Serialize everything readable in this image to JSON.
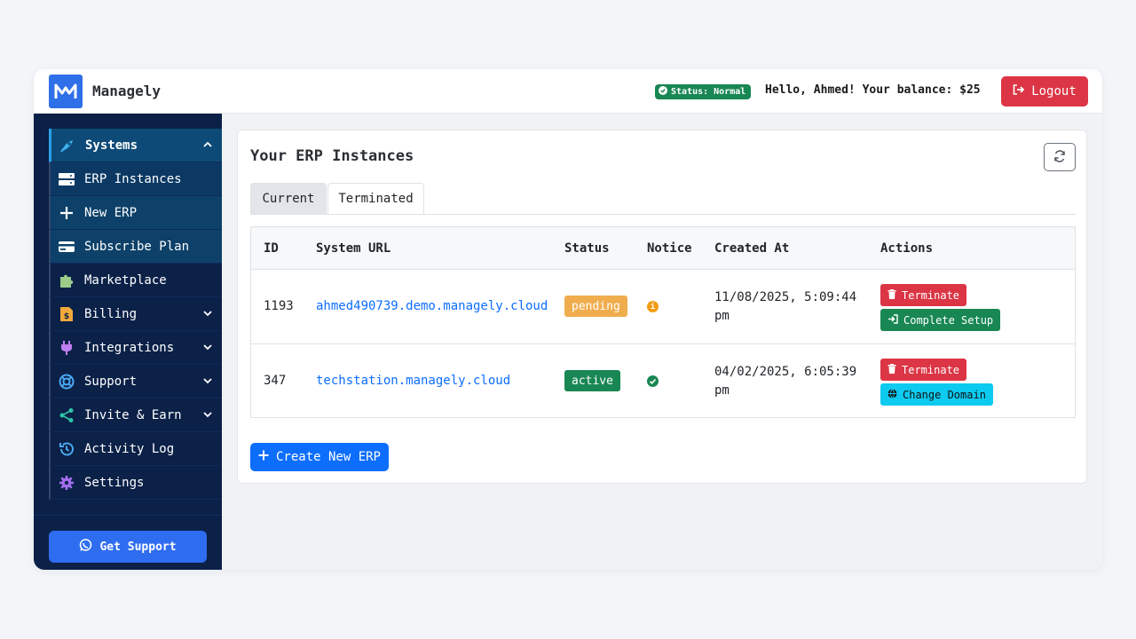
{
  "app": {
    "brand": "Managely"
  },
  "header": {
    "status_label": "Status: Normal",
    "greeting": "Hello, Ahmed! Your balance: $25",
    "logout_label": "Logout"
  },
  "sidebar": {
    "items": [
      {
        "label": "Systems",
        "icon": "rocket-icon"
      },
      {
        "label": "ERP Instances",
        "icon": "server-icon"
      },
      {
        "label": "New ERP",
        "icon": "plus-icon"
      },
      {
        "label": "Subscribe Plan",
        "icon": "credit-card-icon"
      },
      {
        "label": "Marketplace",
        "icon": "puzzle-icon"
      },
      {
        "label": "Billing",
        "icon": "invoice-icon"
      },
      {
        "label": "Integrations",
        "icon": "plug-icon"
      },
      {
        "label": "Support",
        "icon": "lifebuoy-icon"
      },
      {
        "label": "Invite & Earn",
        "icon": "share-icon"
      },
      {
        "label": "Activity Log",
        "icon": "history-icon"
      },
      {
        "label": "Settings",
        "icon": "gear-icon"
      }
    ],
    "support_label": "Get Support"
  },
  "main": {
    "title": "Your ERP Instances",
    "tabs": [
      {
        "label": "Current"
      },
      {
        "label": "Terminated"
      }
    ],
    "table": {
      "columns": [
        "ID",
        "System URL",
        "Status",
        "Notice",
        "Created At",
        "Actions"
      ],
      "rows": [
        {
          "id": "1193",
          "url": "ahmed490739.demo.managely.cloud",
          "status": "pending",
          "created": "11/08/2025, 5:09:44 pm",
          "actions": [
            "Terminate",
            "Complete Setup"
          ]
        },
        {
          "id": "347",
          "url": "techstation.managely.cloud",
          "status": "active",
          "created": "04/02/2025, 6:05:39 pm",
          "actions": [
            "Terminate",
            "Change Domain"
          ]
        }
      ]
    },
    "create_label": "Create New ERP"
  },
  "colors": {
    "sidebar_bg": "#0b2148",
    "primary": "#0d6efd",
    "danger": "#dc3545",
    "success": "#198754",
    "warning": "#f0ad4e",
    "info": "#0dcaf0"
  }
}
